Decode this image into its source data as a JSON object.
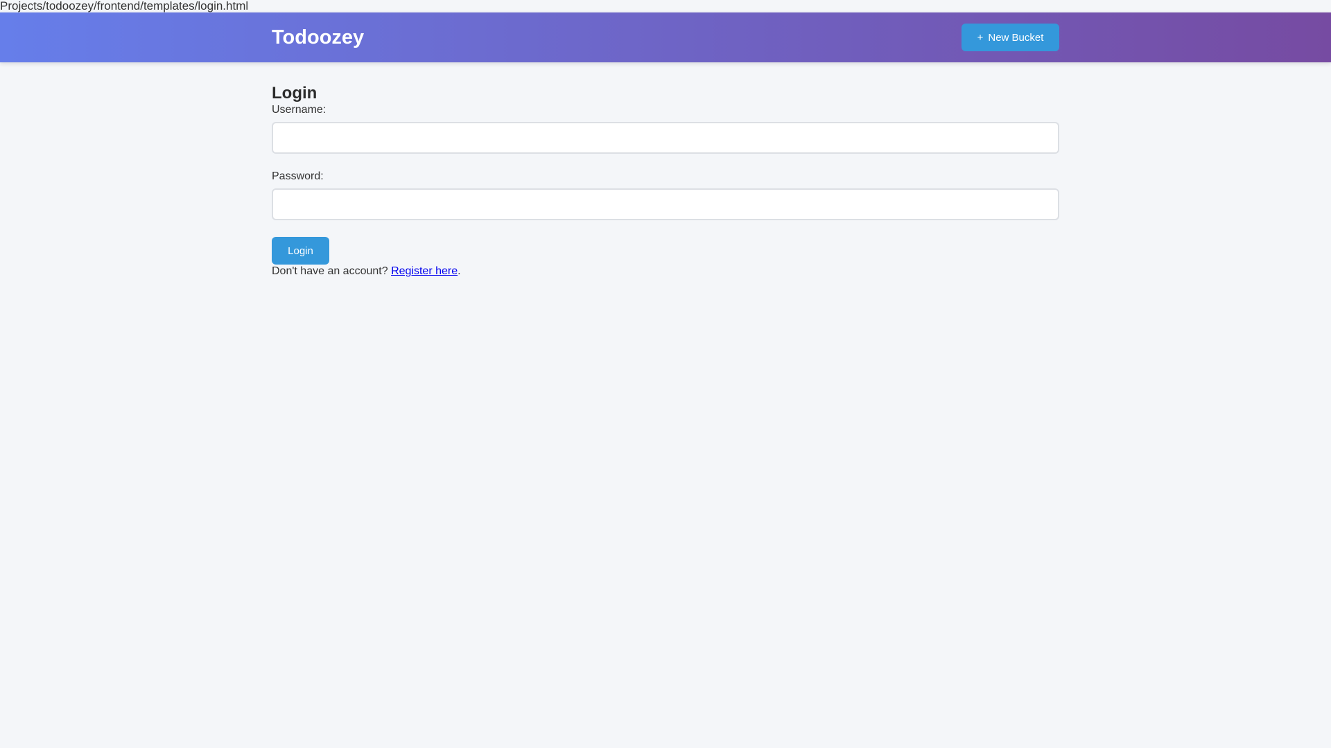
{
  "path_bar": {
    "text": "Projects/todoozey/frontend/templates/login.html"
  },
  "header": {
    "brand": "Todoozey",
    "new_bucket": {
      "icon": "+",
      "label": "New Bucket"
    }
  },
  "login_form": {
    "title": "Login",
    "username_label": "Username:",
    "username_value": "",
    "password_label": "Password:",
    "password_value": "",
    "submit_label": "Login",
    "register_prompt": "Don't have an account?",
    "register_link": "Register here",
    "register_suffix": "."
  },
  "colors": {
    "header_gradient_start": "#667eea",
    "header_gradient_end": "#764ba2",
    "button_blue": "#3498db",
    "link_blue": "#0000ee",
    "page_background": "#f4f6f9"
  }
}
